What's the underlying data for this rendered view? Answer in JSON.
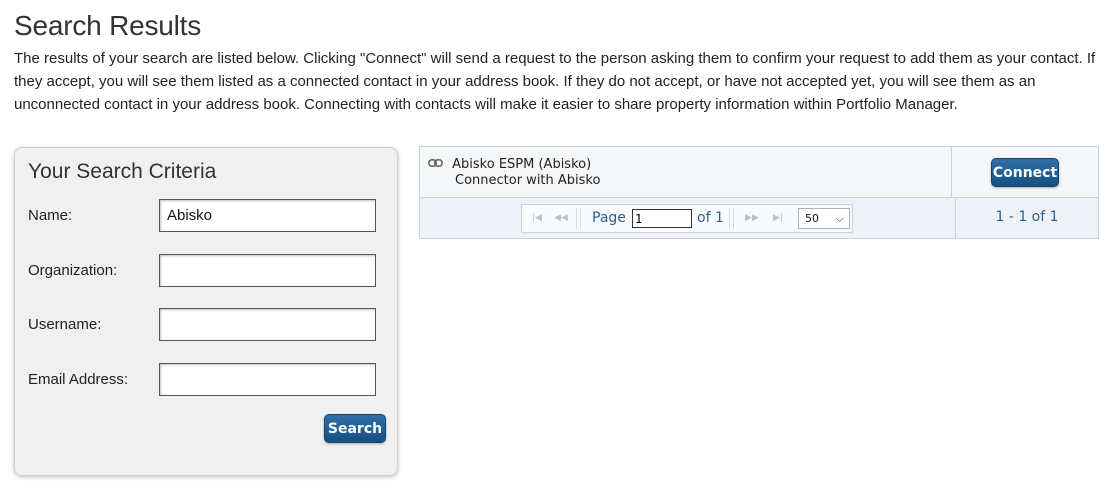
{
  "page": {
    "title": "Search Results",
    "intro": "The results of your search are listed below. Clicking \"Connect\" will send a request to the person asking them to confirm your request to add them as your contact. If they accept, you will see them listed as a connected contact in your address book. If they do not accept, or have not accepted yet, you will see them as an unconnected contact in your address book. Connecting with contacts will make it easier to share property information within Portfolio Manager."
  },
  "criteria": {
    "title": "Your Search Criteria",
    "fields": [
      {
        "label": "Name:",
        "value": "Abisko",
        "placeholder": ""
      },
      {
        "label": "Organization:",
        "value": "",
        "placeholder": ""
      },
      {
        "label": "Username:",
        "value": "",
        "placeholder": ""
      },
      {
        "label": "Email Address:",
        "value": "",
        "placeholder": ""
      }
    ],
    "search_label": "Search"
  },
  "results": {
    "rows": [
      {
        "name": "Abisko ESPM (Abisko)",
        "subtitle": "Connector with Abisko",
        "icon": "link-icon",
        "action_label": "Connect"
      }
    ],
    "pager": {
      "page_label": "Page",
      "current_page": "1",
      "of_label": "of 1",
      "page_size": "50",
      "count_text": "1 - 1 of 1",
      "first_icon": "first-page-icon",
      "prev_icon": "prev-page-icon",
      "next_icon": "next-page-icon",
      "last_icon": "last-page-icon"
    }
  },
  "colors": {
    "button": "#1f5f96",
    "link_text": "#2a5f93",
    "panel_bg": "#f0f0f0"
  }
}
